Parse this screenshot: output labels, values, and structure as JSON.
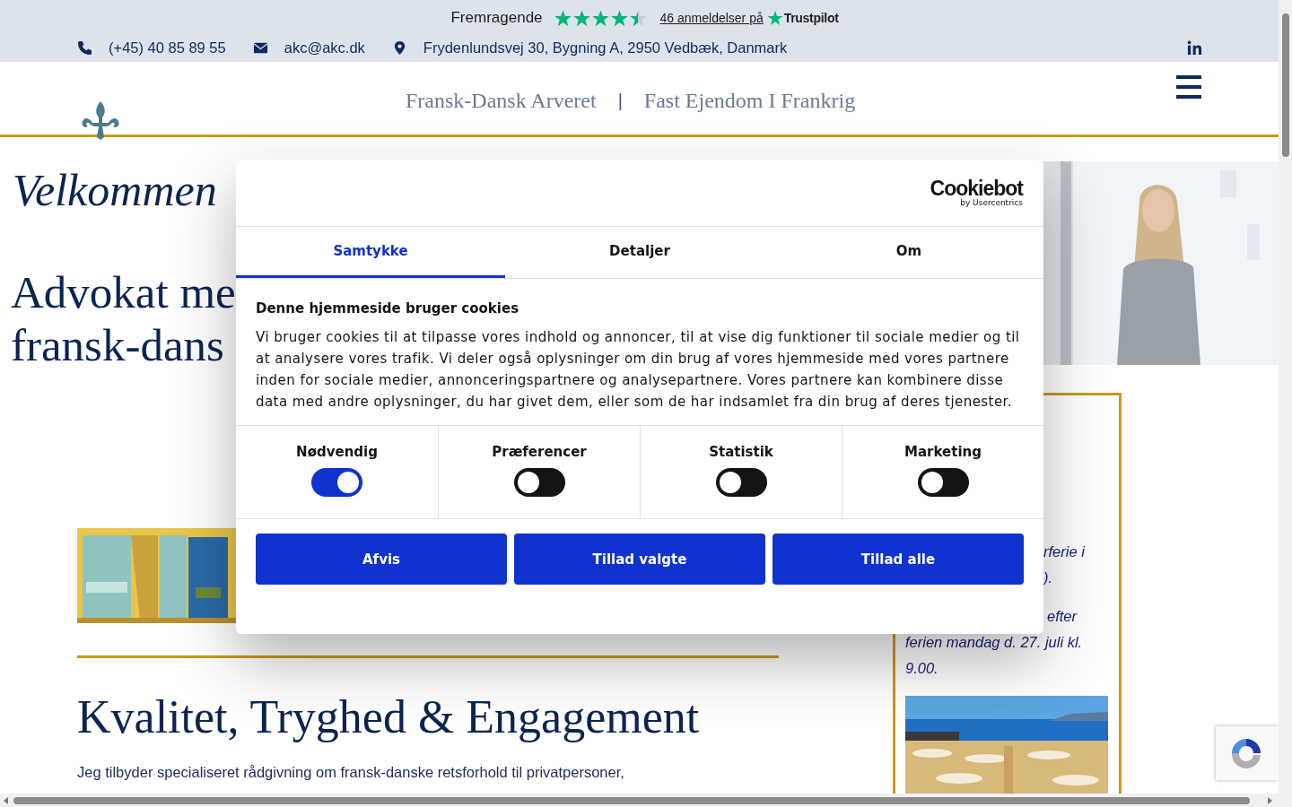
{
  "top_bar": {
    "rating_label": "Fremragende",
    "stars": 4.5,
    "reviews_link": "46 anmeldelser på",
    "brand": "Trustpilot",
    "contacts": [
      {
        "kind": "phone",
        "text": "(+45) 40 85 89 55"
      },
      {
        "kind": "email",
        "text": "akc@akc.dk"
      },
      {
        "kind": "address",
        "text": "Frydenlundsvej 30, Bygning A, 2950 Vedbæk, Danmark"
      }
    ]
  },
  "nav": {
    "links": [
      "Fransk-Dansk Arveret",
      "Fast Ejendom I Frankrig"
    ],
    "separator": "|"
  },
  "hero": {
    "welcome": "Velkommen",
    "title_lines": [
      "Advokat me",
      "fransk-dans"
    ]
  },
  "section": {
    "heading": "Kvalitet, Tryghed & Engagement",
    "paragraph": "Jeg tilbyder specialiseret rådgivning om fransk-danske retsforhold til privatpersoner,"
  },
  "notice": {
    "lines": [
      {
        "kind": "partial",
        "text": "rferie i"
      },
      {
        "kind": "partial",
        "text": ")."
      },
      {
        "kind": "gap",
        "text": "efter"
      },
      {
        "kind": "full",
        "text": "ferien mandag d. 27. juli kl."
      },
      {
        "kind": "full",
        "text": "9.00."
      }
    ]
  },
  "cookie_dialog": {
    "logo": "Cookiebot",
    "logo_sub": "by Usercentrics",
    "tabs": [
      {
        "label": "Samtykke",
        "selected": true
      },
      {
        "label": "Detaljer",
        "selected": false
      },
      {
        "label": "Om",
        "selected": false
      }
    ],
    "title": "Denne hjemmeside bruger cookies",
    "text": "Vi bruger cookies til at tilpasse vores indhold og annoncer, til at vise dig funktioner til sociale medier og til at analysere vores trafik. Vi deler også oplysninger om din brug af vores hjemmeside med vores partnere inden for sociale medier, annonceringspartnere og analysepartnere. Vores partnere kan kombinere disse data med andre oplysninger, du har givet dem, eller som de har indsamlet fra din brug af deres tjenester.",
    "categories": [
      {
        "label": "Nødvendig",
        "on": true
      },
      {
        "label": "Præferencer",
        "on": false
      },
      {
        "label": "Statistik",
        "on": false
      },
      {
        "label": "Marketing",
        "on": false
      }
    ],
    "buttons": [
      "Afvis",
      "Tillad valgte",
      "Tillad alle"
    ]
  }
}
